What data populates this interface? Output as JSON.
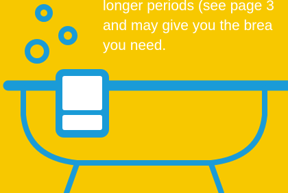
{
  "colors": {
    "background": "#F7C800",
    "line": "#1A9BD7",
    "text": "#FFFFFF"
  },
  "body_text": {
    "lines": [
      "longer periods (see page 3",
      "and may give you the brea",
      "you need."
    ]
  },
  "illustration": {
    "icons": [
      "bubble-icon",
      "bathtub-icon",
      "towel-icon"
    ]
  }
}
